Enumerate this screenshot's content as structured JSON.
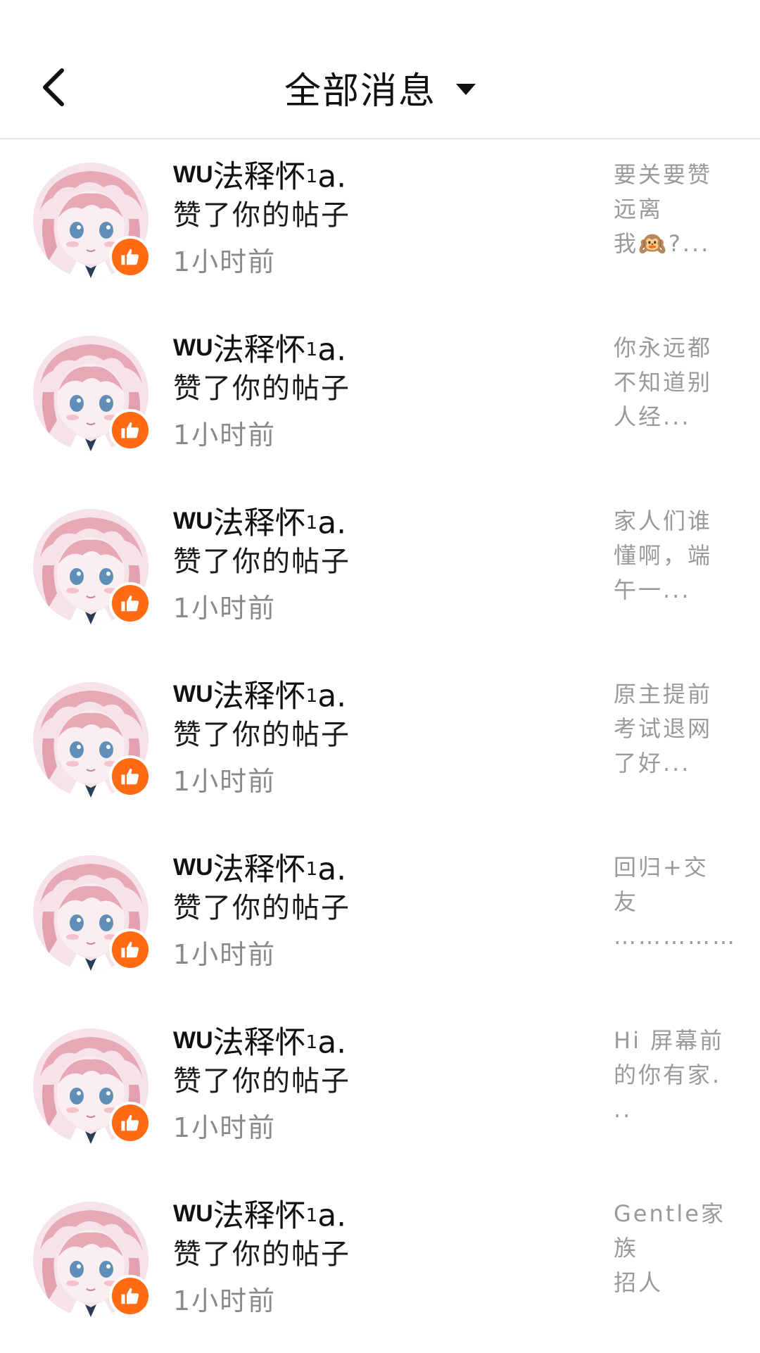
{
  "header": {
    "title": "全部消息",
    "back_icon": "chevron-left-icon",
    "dropdown_icon": "caret-down-icon"
  },
  "colors": {
    "accent": "#ff6a13",
    "text_primary": "#111111",
    "text_secondary": "#8a8a8a"
  },
  "items": [
    {
      "name_prefix": "WU",
      "name_main": "法释怀",
      "name_sup": "1",
      "name_tail": "a.",
      "action": "赞了你的帖子",
      "time": "1小时前",
      "excerpt": "……………\n………"
    },
    {
      "name_prefix": "WU",
      "name_main": "法释怀",
      "name_sup": "1",
      "name_tail": "a.",
      "action": "赞了你的帖子",
      "time": "1小时前",
      "excerpt": "要关要赞\n远离\n我🙉?..."
    },
    {
      "name_prefix": "WU",
      "name_main": "法释怀",
      "name_sup": "1",
      "name_tail": "a.",
      "action": "赞了你的帖子",
      "time": "1小时前",
      "excerpt": "你永远都\n不知道别\n人经..."
    },
    {
      "name_prefix": "WU",
      "name_main": "法释怀",
      "name_sup": "1",
      "name_tail": "a.",
      "action": "赞了你的帖子",
      "time": "1小时前",
      "excerpt": "家人们谁\n懂啊，端\n午一..."
    },
    {
      "name_prefix": "WU",
      "name_main": "法释怀",
      "name_sup": "1",
      "name_tail": "a.",
      "action": "赞了你的帖子",
      "time": "1小时前",
      "excerpt": "原主提前\n考试退网\n了好..."
    },
    {
      "name_prefix": "WU",
      "name_main": "法释怀",
      "name_sup": "1",
      "name_tail": "a.",
      "action": "赞了你的帖子",
      "time": "1小时前",
      "excerpt": "回归+交\n友\n……………"
    },
    {
      "name_prefix": "WU",
      "name_main": "法释怀",
      "name_sup": "1",
      "name_tail": "a.",
      "action": "赞了你的帖子",
      "time": "1小时前",
      "excerpt": "Hi 屏幕前\n的你有家.\n.."
    },
    {
      "name_prefix": "WU",
      "name_main": "法释怀",
      "name_sup": "1",
      "name_tail": "a.",
      "action": "赞了你的帖子",
      "time": "1小时前",
      "excerpt": "Gentle家族\n招人"
    }
  ]
}
